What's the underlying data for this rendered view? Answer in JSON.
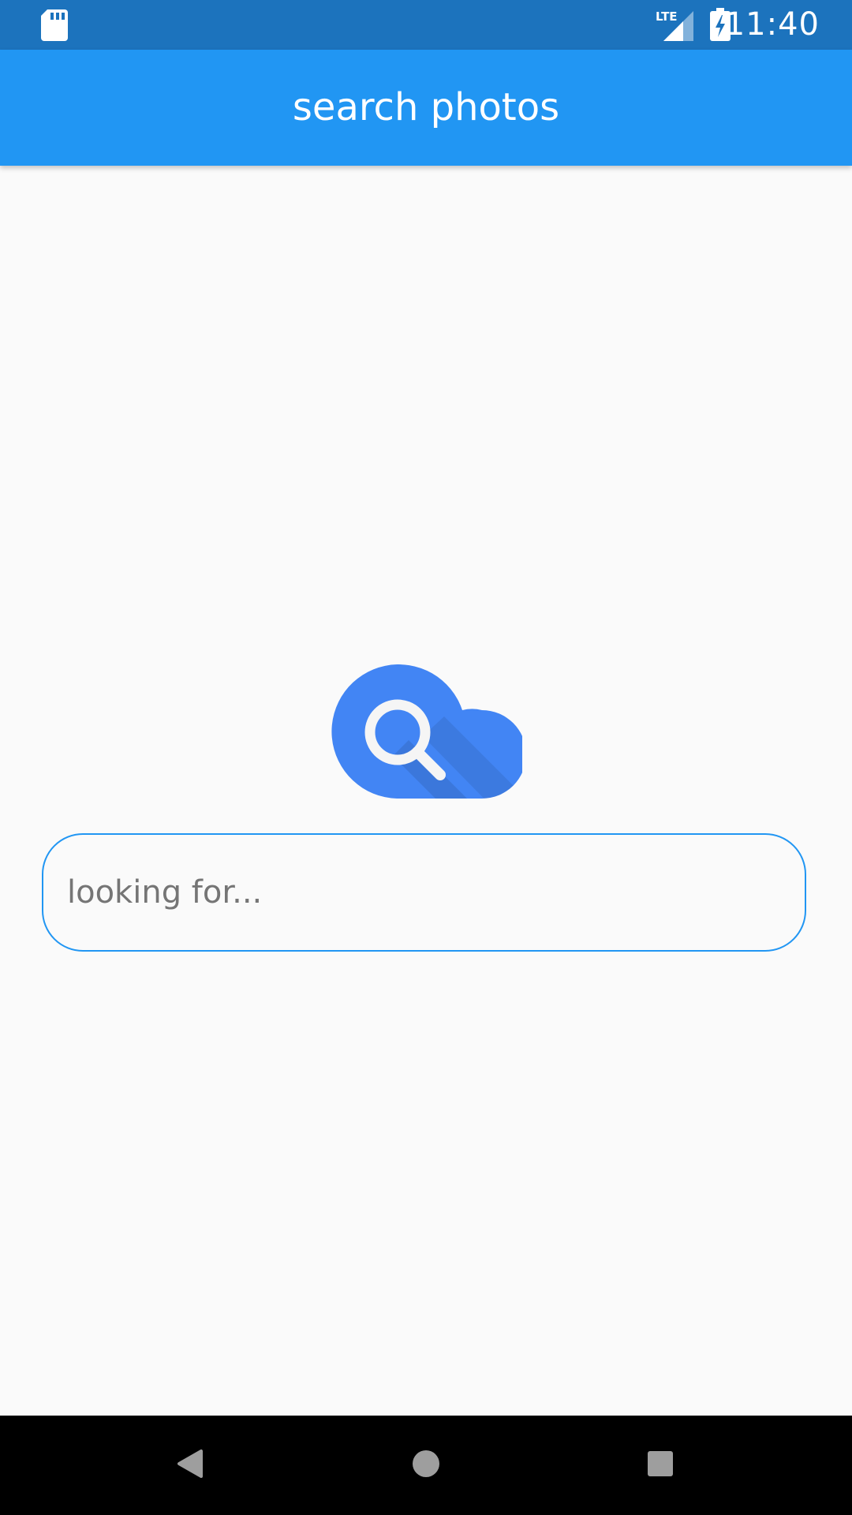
{
  "status_bar": {
    "time": "11:40",
    "network_label": "LTE",
    "icons": [
      "sd-card-icon",
      "lte-signal-icon",
      "battery-charging-icon"
    ]
  },
  "app_bar": {
    "title": "search photos"
  },
  "logo": {
    "icon": "cloud-search-icon"
  },
  "search": {
    "value": "",
    "placeholder": "looking for..."
  },
  "nav_bar": {
    "buttons": [
      "back-icon",
      "home-icon",
      "recents-icon"
    ]
  },
  "colors": {
    "status_bar": "#1c73bd",
    "app_bar": "#2196f3",
    "background": "#fafafa",
    "accent": "#2196f3",
    "logo_cloud": "#4285f4",
    "nav_bar": "#000000"
  }
}
